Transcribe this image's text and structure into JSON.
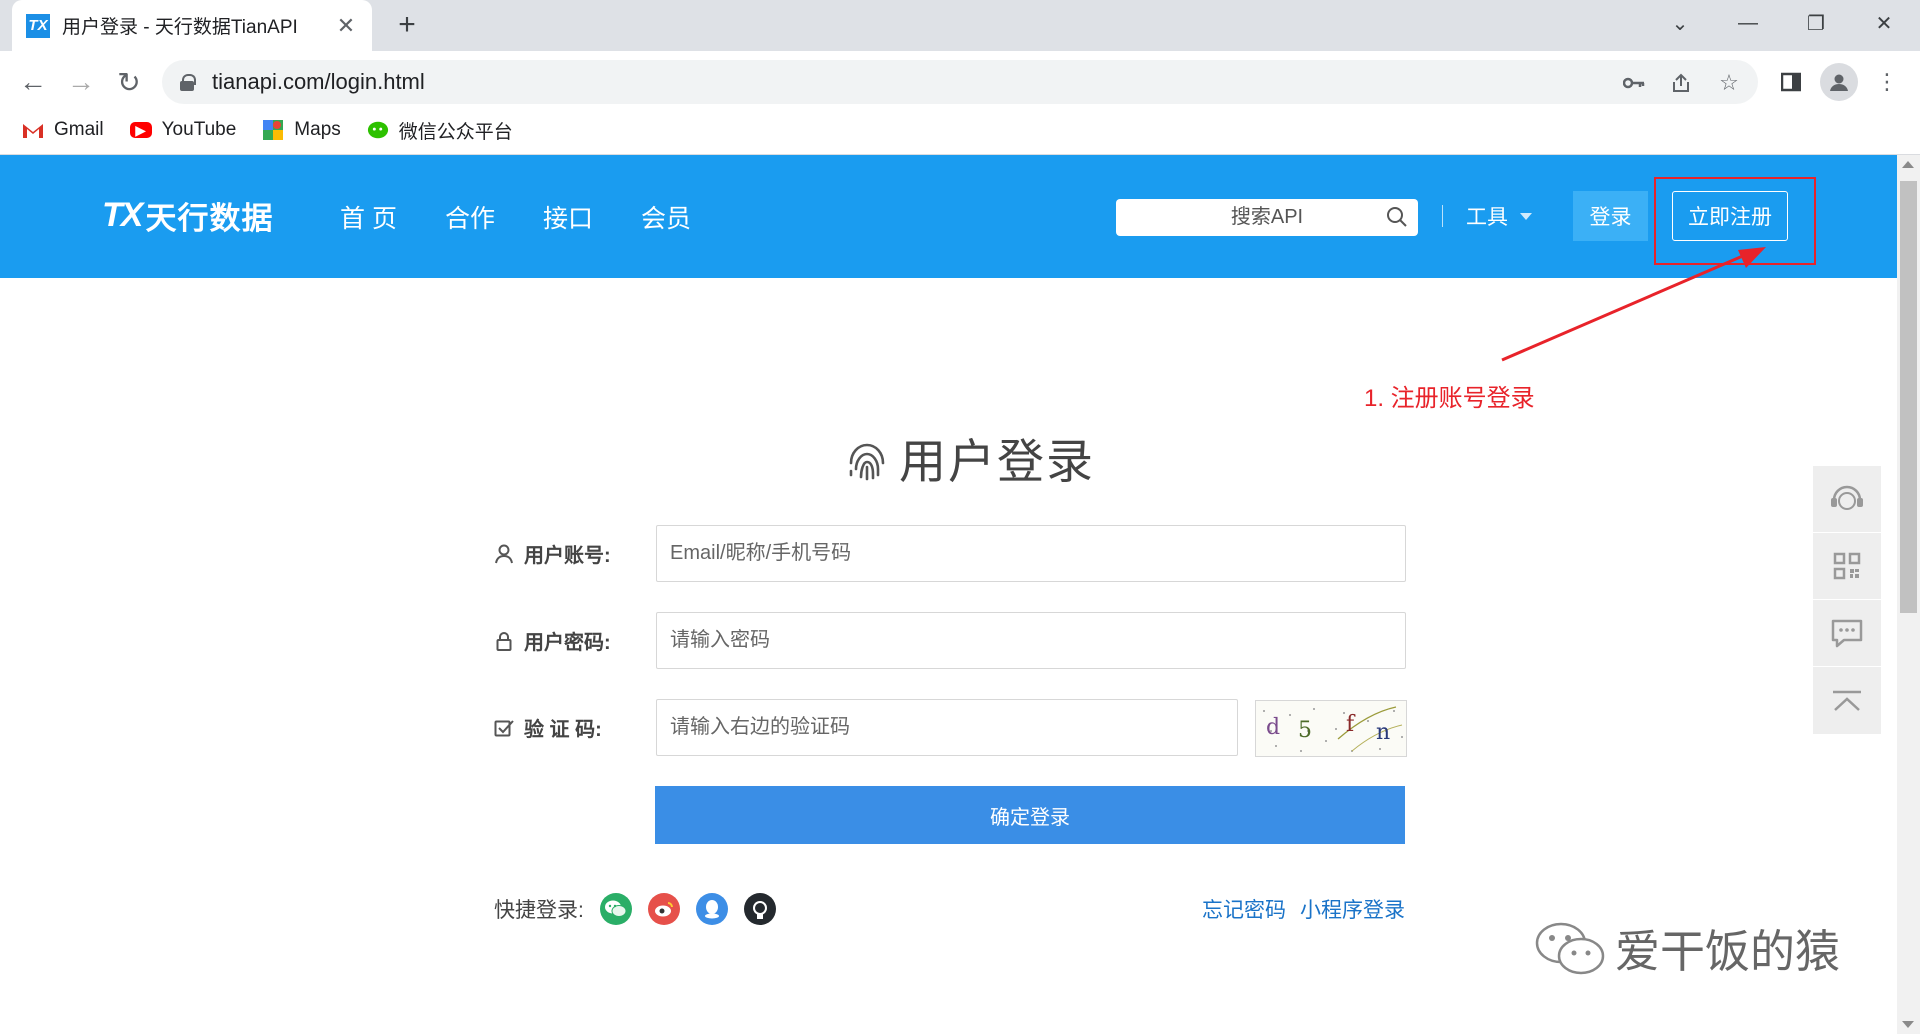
{
  "browser": {
    "tab_title": "用户登录 - 天行数据TianAPI",
    "url": "tianapi.com/login.html",
    "bookmarks": [
      {
        "label": "Gmail",
        "icon": "gmail-icon"
      },
      {
        "label": "YouTube",
        "icon": "youtube-icon"
      },
      {
        "label": "Maps",
        "icon": "maps-icon"
      },
      {
        "label": "微信公众平台",
        "icon": "wechat-icon"
      }
    ]
  },
  "header": {
    "logo_mark": "TX",
    "logo_text": "天行数据",
    "nav": [
      "首 页",
      "合作",
      "接口",
      "会员"
    ],
    "search_placeholder": "搜索API",
    "tools_label": "工具",
    "login_label": "登录",
    "register_label": "立即注册"
  },
  "annotation": {
    "text": "1. 注册账号登录",
    "color": "#e8232a"
  },
  "login": {
    "title": "用户登录",
    "account_label": "用户账号:",
    "account_placeholder": "Email/昵称/手机号码",
    "password_label": "用户密码:",
    "password_placeholder": "请输入密码",
    "captcha_label": "验 证 码:",
    "captcha_placeholder": "请输入右边的验证码",
    "captcha_text": "d5fn",
    "submit_label": "确定登录",
    "quick_login_label": "快捷登录:",
    "forgot_label": "忘记密码",
    "miniprogram_label": "小程序登录"
  },
  "watermark": "爱干饭的猿",
  "colors": {
    "header_bg": "#1a9cf0",
    "submit_bg": "#3a8ee6",
    "link": "#1a73c8"
  }
}
